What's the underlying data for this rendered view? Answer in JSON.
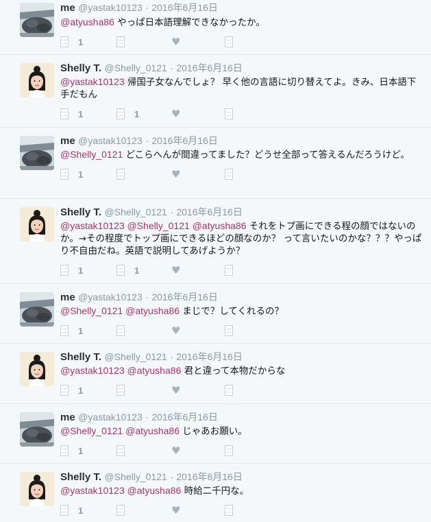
{
  "users": {
    "me": {
      "name": "me",
      "handle": "@yastak10123"
    },
    "shelly": {
      "name": "Shelly T.",
      "handle": "@Shelly_0121"
    }
  },
  "separator": "·",
  "tweets": [
    {
      "name": "me",
      "handle": "@yastak10123",
      "date": "2016年6月16日",
      "mentions": "@atyusha86",
      "body": " やっぱ日本語理解できなかったか。",
      "reply_count": "1",
      "retweet_count": ""
    },
    {
      "name": "Shelly T.",
      "handle": "@Shelly_0121",
      "date": "2016年6月16日",
      "mentions": "@yastak10123",
      "body": " 帰国子女なんでしょ？ 早く他の言語に切り替えてよ。きみ、日本語下手だもん",
      "reply_count": "1",
      "retweet_count": "1"
    },
    {
      "name": "me",
      "handle": "@yastak10123",
      "date": "2016年6月16日",
      "mentions": "@Shelly_0121",
      "body": " どこらへんが間違ってました？どうせ全部って答えるんだろうけど。",
      "reply_count": "1",
      "retweet_count": ""
    },
    {
      "name": "Shelly T.",
      "handle": "@Shelly_0121",
      "date": "2016年6月16日",
      "mentions": "@yastak10123 @Shelly_0121 @atyusha86",
      "body": " それをトプ画にできる程の顔ではないのか。→その程度でトップ画にできるほどの顔なのか？ って言いたいのかな？？？やっぱり不自由だね。英語で説明してあげようか？",
      "reply_count": "1",
      "retweet_count": "1"
    },
    {
      "name": "me",
      "handle": "@yastak10123",
      "date": "2016年6月16日",
      "mentions": "@Shelly_0121 @atyusha86",
      "body": " まじで？してくれるの？",
      "reply_count": "1",
      "retweet_count": ""
    },
    {
      "name": "Shelly T.",
      "handle": "@Shelly_0121",
      "date": "2016年6月16日",
      "mentions": "@yastak10123 @atyusha86",
      "body": " 君と違って本物だからな",
      "reply_count": "1",
      "retweet_count": ""
    },
    {
      "name": "me",
      "handle": "@yastak10123",
      "date": "2016年6月16日",
      "mentions": "@Shelly_0121 @atyusha86",
      "body": " じゃあお願い。",
      "reply_count": "1",
      "retweet_count": ""
    },
    {
      "name": "Shelly T.",
      "handle": "@Shelly_0121",
      "date": "2016年6月16日",
      "mentions": "@yastak10123 @atyusha86",
      "body": " 時給二千円な。",
      "reply_count": "1",
      "retweet_count": ""
    }
  ],
  "icons": {
    "reply": "reply-icon",
    "retweet": "retweet-icon",
    "like": "heart-icon",
    "more": "more-icon"
  },
  "colors": {
    "mention": "#a8326e",
    "muted": "#8899a6",
    "background": "#f5f8fa",
    "divider": "#e1e8ed"
  }
}
